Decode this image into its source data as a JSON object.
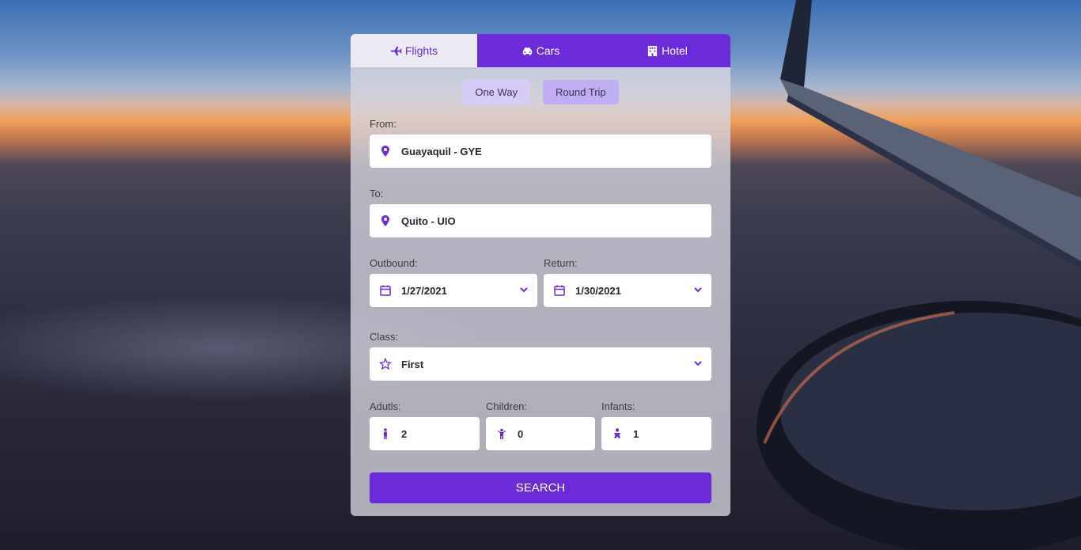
{
  "tabs": {
    "flights": "Flights",
    "cars": "Cars",
    "hotel": "Hotel"
  },
  "trip_type": {
    "one_way": "One Way",
    "round_trip": "Round Trip"
  },
  "from": {
    "label": "From:",
    "value": "Guayaquil - GYE"
  },
  "to": {
    "label": "To:",
    "value": "Quito - UIO"
  },
  "outbound": {
    "label": "Outbound:",
    "value": "1/27/2021"
  },
  "return": {
    "label": "Return:",
    "value": "1/30/2021"
  },
  "class": {
    "label": "Class:",
    "value": "First"
  },
  "adults": {
    "label": "Adutls:",
    "value": "2"
  },
  "children": {
    "label": "Children:",
    "value": "0"
  },
  "infants": {
    "label": "Infants:",
    "value": "1"
  },
  "search_label": "SEARCH",
  "colors": {
    "accent": "#6c2bd9",
    "toggle": "#d7ccf6",
    "toggle_selected": "#c0adf3"
  }
}
